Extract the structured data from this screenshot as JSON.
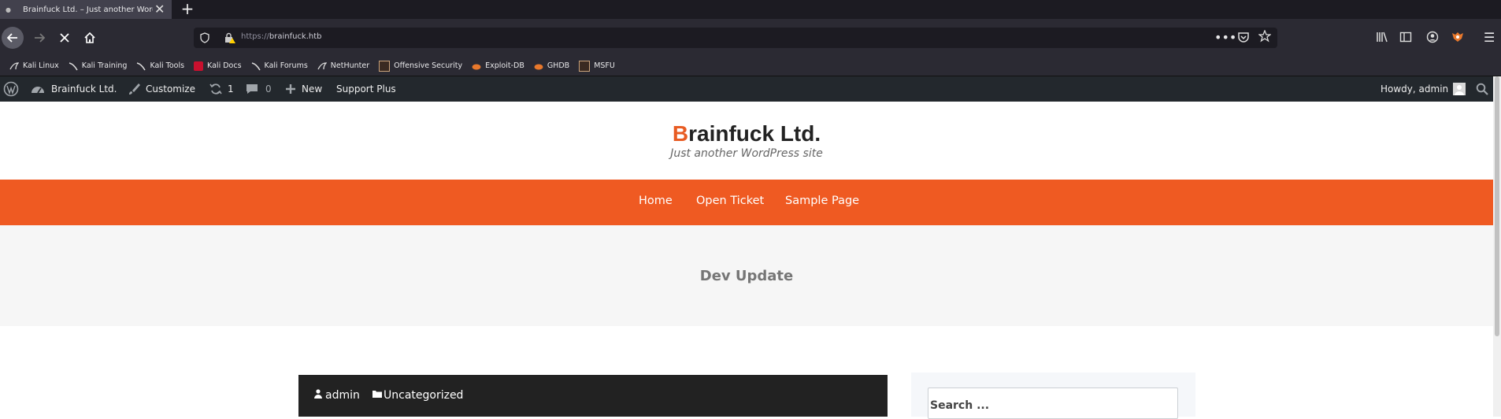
{
  "browser": {
    "tab": {
      "title": "Brainfuck Ltd. – Just another WordPress site",
      "close": "✕"
    },
    "new_tab": "+",
    "url": {
      "scheme": "https://",
      "host": "brainfuck.htb"
    },
    "bookmarks": [
      {
        "label": "Kali Linux",
        "icon": "kali-dragon-icon"
      },
      {
        "label": "Kali Training",
        "icon": "kali-dragon-icon"
      },
      {
        "label": "Kali Tools",
        "icon": "kali-dragon-icon"
      },
      {
        "label": "Kali Docs",
        "icon": "kali-docs-icon"
      },
      {
        "label": "Kali Forums",
        "icon": "kali-dragon-icon"
      },
      {
        "label": "NetHunter",
        "icon": "nethunter-icon"
      },
      {
        "label": "Offensive Security",
        "icon": "offsec-icon"
      },
      {
        "label": "Exploit-DB",
        "icon": "exploitdb-icon"
      },
      {
        "label": "GHDB",
        "icon": "exploitdb-icon"
      },
      {
        "label": "MSFU",
        "icon": "offsec-icon"
      }
    ]
  },
  "adminbar": {
    "site_name": "Brainfuck Ltd.",
    "customize": "Customize",
    "updates_count": "1",
    "comments_count": "0",
    "new": "New",
    "support_plus": "Support Plus",
    "howdy": "Howdy, admin"
  },
  "site": {
    "title_first": "B",
    "title_rest": "rainfuck Ltd.",
    "tagline": "Just another WordPress site",
    "nav": [
      "Home",
      "Open Ticket",
      "Sample Page"
    ],
    "page_heading": "Dev Update"
  },
  "post": {
    "author": "admin",
    "category": "Uncategorized"
  },
  "sidebar": {
    "search_placeholder": "Search ..."
  },
  "colors": {
    "accent": "#ef5a22",
    "adminbar": "#23282d",
    "browser_dark": "#2b2a33"
  }
}
